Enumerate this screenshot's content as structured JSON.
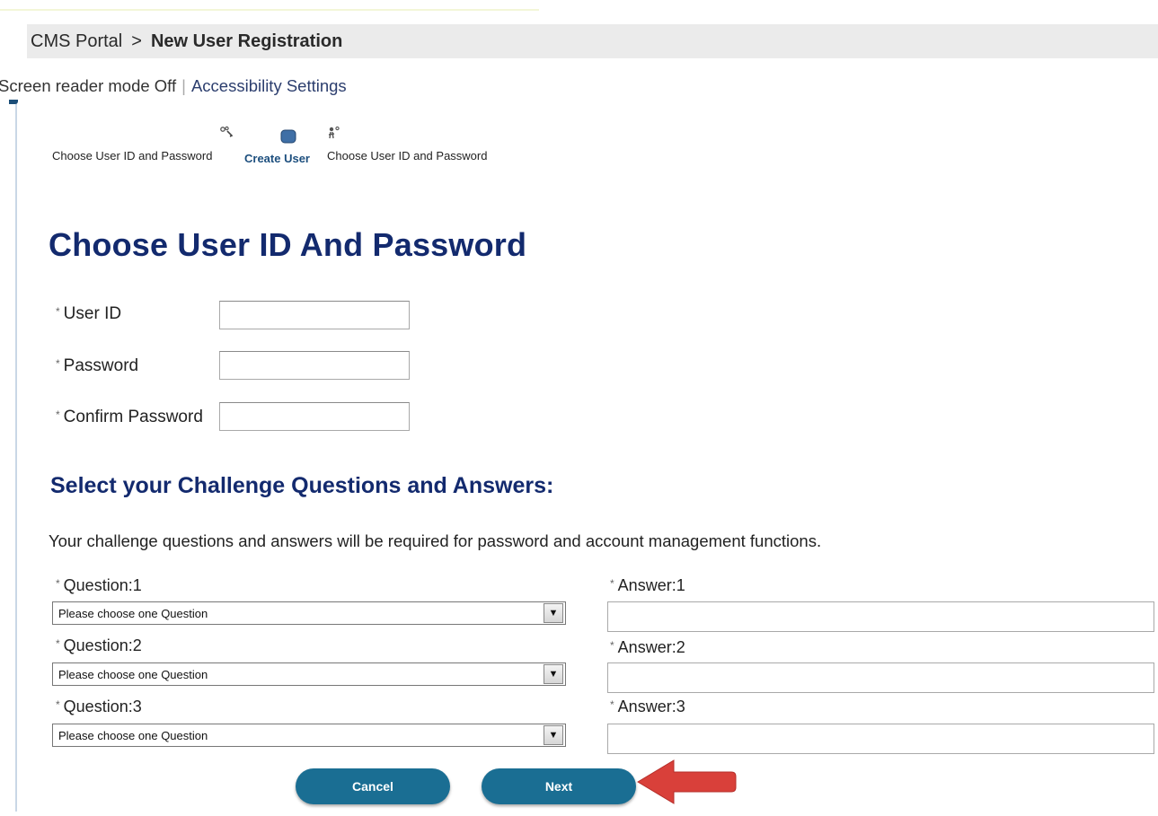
{
  "breadcrumb": {
    "root": "CMS Portal",
    "separator": ">",
    "current": "New User Registration"
  },
  "accessibility": {
    "screen_reader": "Screen reader mode Off",
    "divider": "|",
    "settings_link": "Accessibility Settings"
  },
  "steps": [
    {
      "label": "Choose User ID and Password",
      "icon": "key-icon"
    },
    {
      "label": "Create User",
      "icon": "user-square-icon",
      "current": true
    },
    {
      "label": "Choose User ID and Password",
      "icon": "person-key-icon"
    }
  ],
  "page_title": "Choose User ID And Password",
  "fields": {
    "user_id": {
      "label": "User ID",
      "value": ""
    },
    "password": {
      "label": "Password",
      "value": ""
    },
    "confirm_password": {
      "label": "Confirm Password",
      "value": ""
    },
    "required_marker": "*"
  },
  "challenge": {
    "title": "Select your Challenge Questions and Answers:",
    "info": "Your challenge questions and answers will be required for password and account management functions.",
    "questions": [
      {
        "label": "Question:1",
        "selected": "Please choose one Question",
        "answer_label": "Answer:1",
        "answer_value": ""
      },
      {
        "label": "Question:2",
        "selected": "Please choose one Question",
        "answer_label": "Answer:2",
        "answer_value": ""
      },
      {
        "label": "Question:3",
        "selected": "Please choose one Question",
        "answer_label": "Answer:3",
        "answer_value": ""
      }
    ]
  },
  "buttons": {
    "cancel": "Cancel",
    "next": "Next"
  },
  "colors": {
    "heading": "#132a6e",
    "button": "#1a6e93",
    "callout_arrow": "#d9403a"
  }
}
